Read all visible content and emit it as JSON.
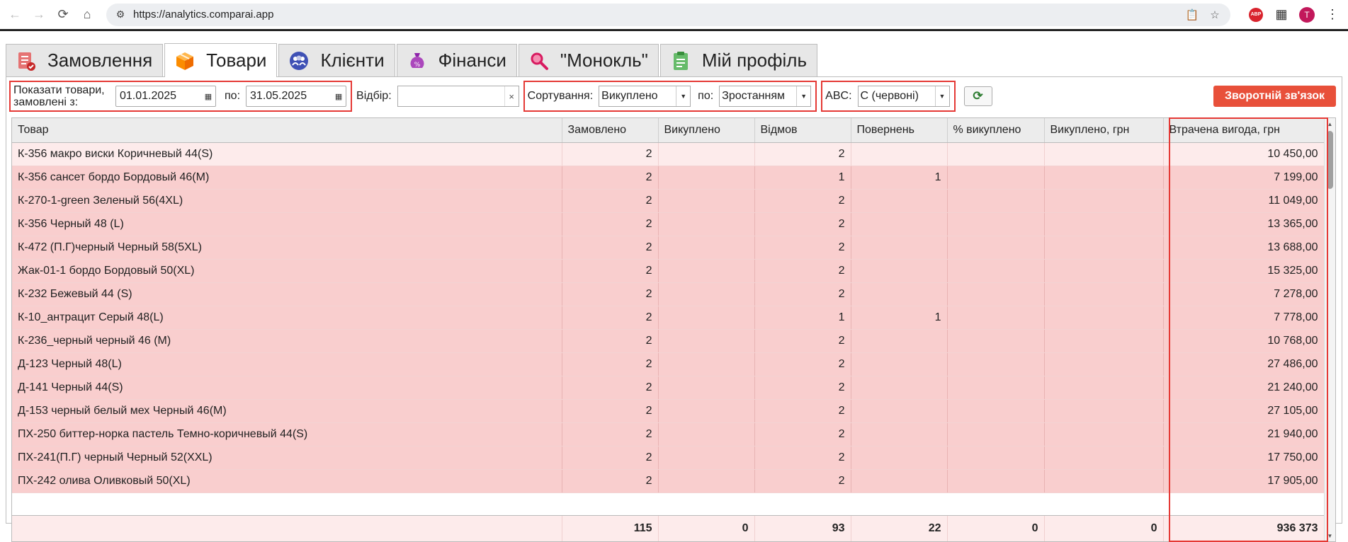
{
  "browser": {
    "url": "https://analytics.comparai.app",
    "profile_initial": "T",
    "abp_label": "ABP"
  },
  "tabs": [
    {
      "label": "Замовлення",
      "active": false
    },
    {
      "label": "Товари",
      "active": true
    },
    {
      "label": "Клієнти",
      "active": false
    },
    {
      "label": "Фінанси",
      "active": false
    },
    {
      "label": "\"Монокль\"",
      "active": false
    },
    {
      "label": "Мій профіль",
      "active": false
    }
  ],
  "toolbar": {
    "show_label": "Показати товари, замовлені з:",
    "date_from": "01.01.2025",
    "to_label": "по:",
    "date_to": "31.05.2025",
    "filter_label": "Відбір:",
    "filter_value": "",
    "sort_label": "Сортування:",
    "sort_value": "Викуплено",
    "sort_by_label": "по:",
    "sort_order": "Зростанням",
    "abc_label": "ABC:",
    "abc_value": "C (червоні)",
    "feedback": "Зворотній зв'язок"
  },
  "table": {
    "columns": [
      "Товар",
      "Замовлено",
      "Викуплено",
      "Відмов",
      "Повернень",
      "% викуплено",
      "Викуплено, грн",
      "Втрачена вигода, грн"
    ],
    "rows": [
      [
        "К-356 макро виски Коричневый 44(S)",
        "2",
        "",
        "2",
        "",
        "",
        "",
        "10 450,00"
      ],
      [
        "К-356 сансет бордо Бордовый 46(M)",
        "2",
        "",
        "1",
        "1",
        "",
        "",
        "7 199,00"
      ],
      [
        "К-270-1-green Зеленый 56(4XL)",
        "2",
        "",
        "2",
        "",
        "",
        "",
        "11 049,00"
      ],
      [
        "К-356 Черный 48 (L)",
        "2",
        "",
        "2",
        "",
        "",
        "",
        "13 365,00"
      ],
      [
        "К-472 (П.Г)черный Черный 58(5XL)",
        "2",
        "",
        "2",
        "",
        "",
        "",
        "13 688,00"
      ],
      [
        "Жак-01-1 бордо Бордовый 50(XL)",
        "2",
        "",
        "2",
        "",
        "",
        "",
        "15 325,00"
      ],
      [
        "К-232 Бежевый 44 (S)",
        "2",
        "",
        "2",
        "",
        "",
        "",
        "7 278,00"
      ],
      [
        "К-10_антрацит Серый 48(L)",
        "2",
        "",
        "1",
        "1",
        "",
        "",
        "7 778,00"
      ],
      [
        "К-236_черный черный 46 (M)",
        "2",
        "",
        "2",
        "",
        "",
        "",
        "10 768,00"
      ],
      [
        "Д-123 Черный 48(L)",
        "2",
        "",
        "2",
        "",
        "",
        "",
        "27 486,00"
      ],
      [
        "Д-141 Черный 44(S)",
        "2",
        "",
        "2",
        "",
        "",
        "",
        "21 240,00"
      ],
      [
        "Д-153 черный белый мех Черный 46(M)",
        "2",
        "",
        "2",
        "",
        "",
        "",
        "27 105,00"
      ],
      [
        "ПХ-250 биттер-норка пастель Темно-коричневый 44(S)",
        "2",
        "",
        "2",
        "",
        "",
        "",
        "21 940,00"
      ],
      [
        "ПХ-241(П.Г) черный Черный 52(XXL)",
        "2",
        "",
        "2",
        "",
        "",
        "",
        "17 750,00"
      ],
      [
        "ПХ-242 олива Оливковый 50(XL)",
        "2",
        "",
        "2",
        "",
        "",
        "",
        "17 905,00"
      ]
    ],
    "totals": [
      "",
      "115",
      "0",
      "93",
      "22",
      "0",
      "0",
      "936 373"
    ]
  }
}
